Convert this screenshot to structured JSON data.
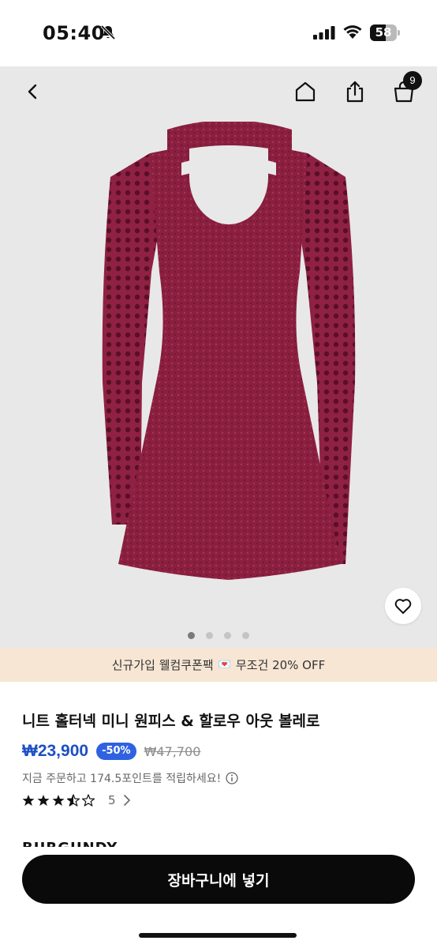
{
  "status_bar": {
    "time": "05:40",
    "battery_level": "58",
    "icons": [
      "bell-slash-icon",
      "signal-icon",
      "wifi-icon",
      "battery-icon"
    ]
  },
  "header": {
    "cart_count": "9",
    "icons": [
      "chevron-left-icon",
      "home-icon",
      "share-icon",
      "shopping-bag-icon"
    ]
  },
  "gallery": {
    "image_count": 4,
    "active_index": 0,
    "dress_color": "#8a1f3f"
  },
  "promo": {
    "text_before": "신규가입 웰컴쿠폰팩",
    "text_after": "무조건 20% OFF"
  },
  "product": {
    "title": "니트 홀터넥 미니 원피스 & 할로우 아웃 볼레로",
    "price": "₩23,900",
    "discount": "-50%",
    "original_price": "₩47,700",
    "points_text": "지금 주문하고 174.5포인트를 적립하세요!",
    "rating": 3.5,
    "review_count": "5",
    "color_label": "BURGUNDY"
  },
  "actions": {
    "add_to_cart": "장바구니에 넣기"
  },
  "colors": {
    "price_blue": "#1d4fc4",
    "badge_blue": "#2f62e0",
    "promo_bg": "#f7e6d4",
    "button_black": "#0a0a0a"
  }
}
